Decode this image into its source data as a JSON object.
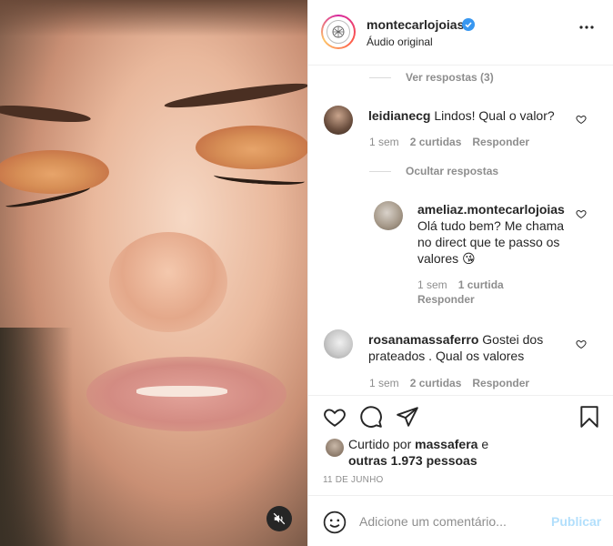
{
  "post": {
    "username": "montecarlojoias",
    "subtitle": "Áudio original"
  },
  "comments": {
    "view_replies_label": "Ver respostas (3)",
    "hide_replies_label": "Ocultar respostas",
    "items": [
      {
        "username": "leidianecg",
        "text": "Lindos! Qual o valor?",
        "time": "1 sem",
        "likes": "2 curtidas",
        "reply": "Responder"
      },
      {
        "username": "ameliaz.montecarlojoias",
        "text": "Olá tudo bem? Me chama no direct que te passo os valores 😘",
        "time": "1 sem",
        "likes": "1 curtida",
        "reply": "Responder"
      },
      {
        "username": "rosanamassaferro",
        "text": "Gostei dos prateados . Qual os valores",
        "time": "1 sem",
        "likes": "2 curtidas",
        "reply": "Responder"
      }
    ]
  },
  "likes": {
    "prefix": "Curtido por ",
    "user": "massafera",
    "middle": " e",
    "others": "outras 1.973 pessoas"
  },
  "date": "11 DE JUNHO",
  "composer": {
    "placeholder": "Adicione um comentário...",
    "post_label": "Publicar"
  },
  "colors": {
    "verified": "#3897f0",
    "publish_disabled": "#b2dffc",
    "muted_text": "#8e8e8e"
  }
}
